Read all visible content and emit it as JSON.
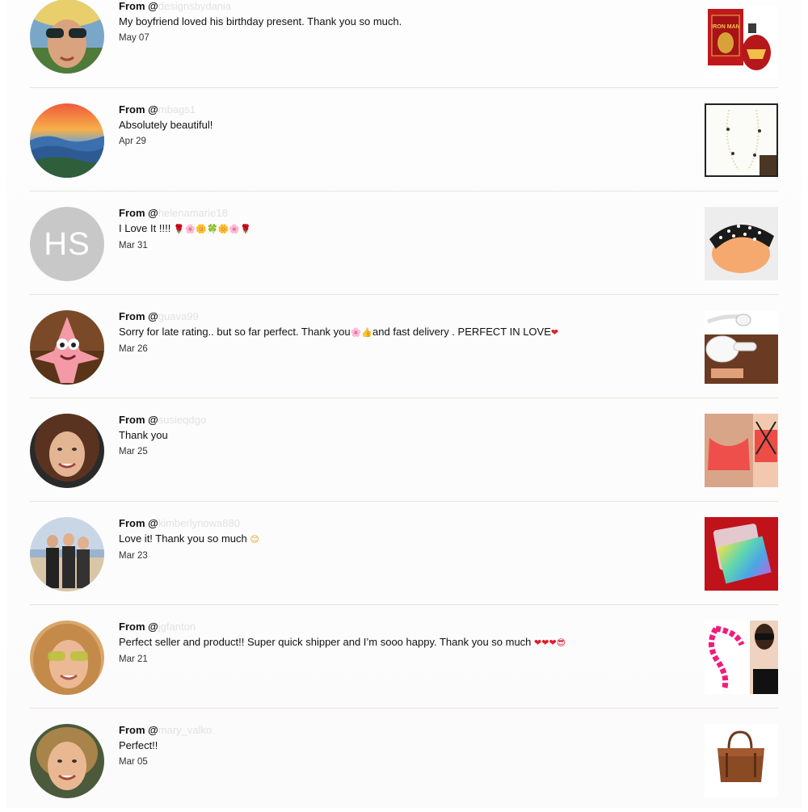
{
  "reviews": [
    {
      "from_prefix": "From @",
      "handle": "designsbydania",
      "comment": "My boyfriend loved his birthday present. Thank you so much.",
      "date": "May 07",
      "avatar": "photo-woman-sunglasses",
      "product": "iron-man-perfume"
    },
    {
      "from_prefix": "From @",
      "handle": "mbags1",
      "comment": "Absolutely beautiful!",
      "date": "Apr 29",
      "avatar": "photo-mountain-sunset",
      "product": "pearl-necklace"
    },
    {
      "from_prefix": "From @",
      "handle": "helenamarie18",
      "comment": "I Love It !!!! ",
      "comment_emoji": "🌹🌸🌼🍀🌼🌸🌹",
      "date": "Mar 31",
      "avatar_initials": "HS",
      "product": "polka-dot-headband"
    },
    {
      "from_prefix": "From @",
      "handle": "guava99",
      "comment_part1": "Sorry for late rating.. but so far perfect. Thank you",
      "comment_emoji1": "🌸👍",
      "comment_part2": "and fast delivery . PERFECT IN LOVE",
      "comment_emoji2": "❤",
      "date": "Mar 26",
      "avatar": "photo-patrick-star",
      "product": "wireless-earbuds"
    },
    {
      "from_prefix": "From @",
      "handle": "susieqdgo",
      "comment": "Thank you",
      "date": "Mar 25",
      "avatar": "photo-woman-smiling",
      "product": "coral-sports-bra"
    },
    {
      "from_prefix": "From @",
      "handle": "kimberlynowa880",
      "comment": "Love it! Thank you so much ",
      "comment_emoji": "😊",
      "date": "Mar 23",
      "avatar": "photo-three-people-beach",
      "product": "holographic-card"
    },
    {
      "from_prefix": "From @",
      "handle": "jgfanton",
      "comment": "Perfect seller and product!! Super quick shipper and I’m sooo happy. Thank you so much ",
      "comment_emoji": "❤❤❤😎",
      "date": "Mar 21",
      "avatar": "photo-woman-yellow-sunglasses",
      "product": "pink-chain-glasses-strap"
    },
    {
      "from_prefix": "From @",
      "handle": "mary_valko",
      "comment": "Perfect!!",
      "date": "Mar 05",
      "avatar": "photo-woman-curly-hair",
      "product": "brown-leather-tote"
    }
  ],
  "colors": {
    "divider": "#e8e4d8",
    "handle_text": "#e2e2e2",
    "heart": "#e21b2b"
  }
}
